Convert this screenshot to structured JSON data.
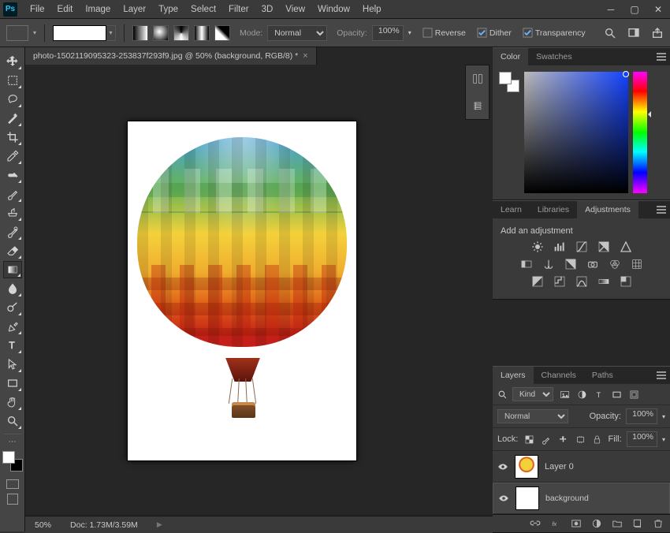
{
  "menu": [
    "File",
    "Edit",
    "Image",
    "Layer",
    "Type",
    "Select",
    "Filter",
    "3D",
    "View",
    "Window",
    "Help"
  ],
  "optbar": {
    "mode_label": "Mode:",
    "mode_value": "Normal",
    "opacity_label": "Opacity:",
    "opacity_value": "100%",
    "reverse_label": "Reverse",
    "reverse_checked": false,
    "dither_label": "Dither",
    "dither_checked": true,
    "transparency_label": "Transparency",
    "transparency_checked": true
  },
  "doc": {
    "tab_title": "photo-1502119095323-253837f293f9.jpg @ 50% (background, RGB/8) *"
  },
  "status": {
    "zoom": "50%",
    "doc_info": "Doc: 1.73M/3.59M"
  },
  "panels": {
    "color": {
      "tabs": [
        "Color",
        "Swatches"
      ],
      "active": 0
    },
    "adjust": {
      "tabs": [
        "Learn",
        "Libraries",
        "Adjustments"
      ],
      "active": 2,
      "heading": "Add an adjustment"
    },
    "layers": {
      "tabs": [
        "Layers",
        "Channels",
        "Paths"
      ],
      "active": 0,
      "filter_kind_label": "Kind",
      "blend_mode": "Normal",
      "opacity_label": "Opacity:",
      "opacity_value": "100%",
      "lock_label": "Lock:",
      "fill_label": "Fill:",
      "fill_value": "100%",
      "items": [
        {
          "name": "Layer 0",
          "selected": false,
          "thumb": "balloon"
        },
        {
          "name": "background",
          "selected": true,
          "thumb": "plain"
        }
      ]
    }
  },
  "tool_names": [
    "move",
    "marquee",
    "lasso",
    "magic-wand",
    "crop",
    "eyedropper",
    "spot-heal",
    "brush",
    "clone-stamp",
    "history-brush",
    "eraser",
    "gradient",
    "blur",
    "dodge",
    "pen",
    "type",
    "path-select",
    "rectangle",
    "hand",
    "zoom"
  ],
  "active_tool_index": 11
}
